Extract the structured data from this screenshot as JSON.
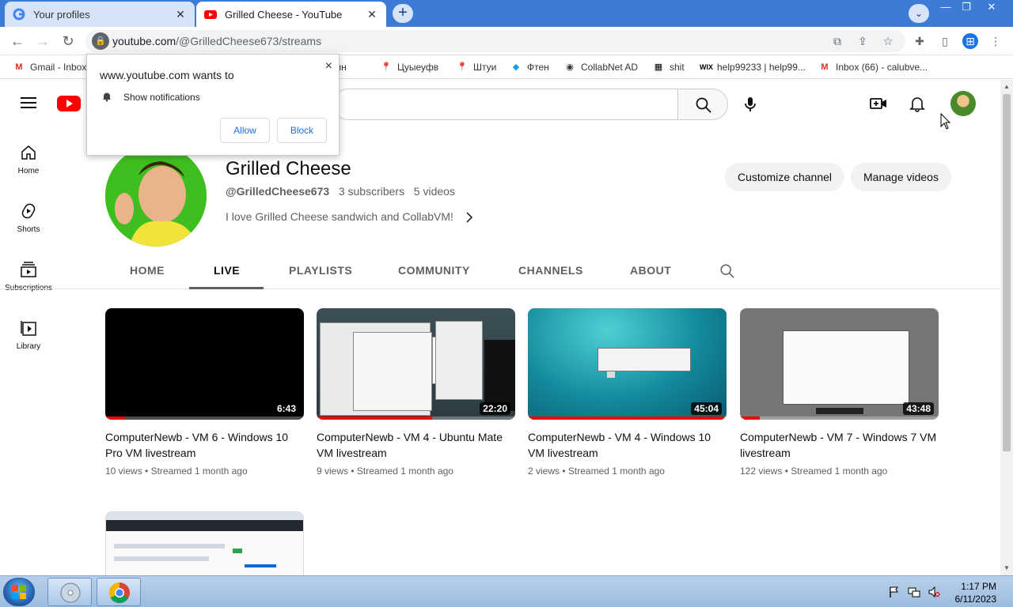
{
  "browser": {
    "tabs": [
      {
        "title": "Your profiles",
        "close": "✕"
      },
      {
        "title": "Grilled Cheese - YouTube",
        "close": "✕"
      }
    ],
    "new_tab": "+",
    "tab_search": "⌄",
    "window_buttons": {
      "minimize": "—",
      "restore": "❐",
      "close": "✕"
    },
    "url_host": "youtube.com",
    "url_path": "/@GrilledCheese673/streams",
    "bookmarks": [
      {
        "label": "Gmail - Inbox",
        "icon": "gmail-icon"
      },
      {
        "label": "згыын",
        "icon": "map-pin-icon"
      },
      {
        "label": "Цуыеуфв",
        "icon": "map-pin-icon"
      },
      {
        "label": "Штуи",
        "icon": "map-pin-icon"
      },
      {
        "label": "Фтен",
        "icon": "diamond-icon"
      },
      {
        "label": "CollabNet AD",
        "icon": "globe-icon"
      },
      {
        "label": "shit",
        "icon": "badge-icon"
      },
      {
        "label": "help99233 | help99...",
        "icon": "wix-icon"
      },
      {
        "label": "Inbox (66) - calubve...",
        "icon": "gmail-icon"
      }
    ]
  },
  "permission_popup": {
    "title": "www.youtube.com wants to",
    "text": "Show notifications",
    "allow": "Allow",
    "block": "Block",
    "close": "×"
  },
  "sidebar": {
    "items": [
      {
        "label": "Home",
        "icon": "home-icon"
      },
      {
        "label": "Shorts",
        "icon": "shorts-icon"
      },
      {
        "label": "Subscriptions",
        "icon": "subscriptions-icon"
      },
      {
        "label": "Library",
        "icon": "library-icon"
      }
    ]
  },
  "channel": {
    "name": "Grilled Cheese",
    "handle": "@GrilledCheese673",
    "subscribers": "3 subscribers",
    "videos_count": "5 videos",
    "description": "I love Grilled Cheese sandwich and CollabVM!",
    "customize_label": "Customize channel",
    "manage_label": "Manage videos"
  },
  "channel_tabs": [
    "HOME",
    "LIVE",
    "PLAYLISTS",
    "COMMUNITY",
    "CHANNELS",
    "ABOUT"
  ],
  "active_tab": "LIVE",
  "videos": [
    {
      "title": "ComputerNewb - VM 6 - Windows 10 Pro VM livestream",
      "views": "10 views",
      "when": "Streamed 1 month ago",
      "duration": "6:43",
      "watched": 0.1,
      "thumb": "black"
    },
    {
      "title": "ComputerNewb - VM 4 - Ubuntu Mate VM livestream",
      "views": "9 views",
      "when": "Streamed 1 month ago",
      "duration": "22:20",
      "watched": 0.58,
      "thumb": "desktop"
    },
    {
      "title": "ComputerNewb - VM 4 - Windows 10 VM livestream",
      "views": "2 views",
      "when": "Streamed 1 month ago",
      "duration": "45:04",
      "watched": 0.99,
      "thumb": "ocean"
    },
    {
      "title": "ComputerNewb - VM 7 - Windows 7 VM livestream",
      "views": "122 views",
      "when": "Streamed 1 month ago",
      "duration": "43:48",
      "watched": 0.1,
      "thumb": "gray"
    },
    {
      "title": "",
      "views": "",
      "when": "",
      "duration": "",
      "watched": 0,
      "thumb": "github"
    }
  ],
  "taskbar": {
    "time": "1:17 PM",
    "date": "6/11/2023"
  },
  "colors": {
    "tabstrip": "#3c7bd6",
    "youtube_red": "#ff0000",
    "progress_red": "#ff0000"
  }
}
